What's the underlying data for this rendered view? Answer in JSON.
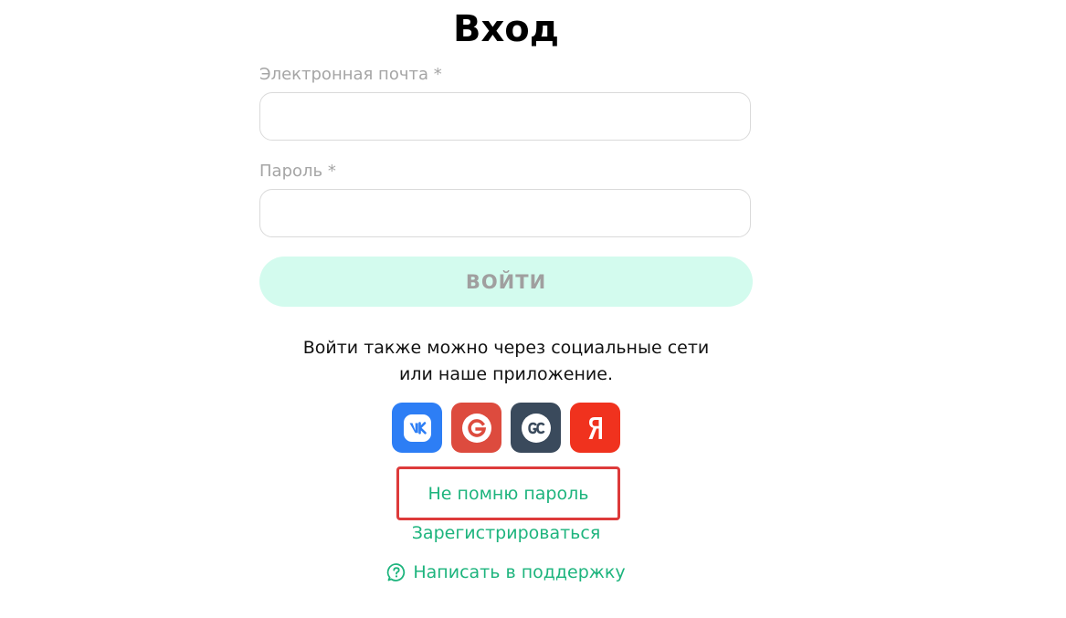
{
  "page": {
    "title": "Вход"
  },
  "form": {
    "email_label": "Электронная почта *",
    "email_value": "",
    "password_label": "Пароль *",
    "password_value": "",
    "submit_label": "ВОЙТИ"
  },
  "social": {
    "hint_line1": "Войти также можно через социальные сети",
    "hint_line2": "или наше приложение.",
    "buttons": [
      {
        "name": "vk",
        "glyph": "VK",
        "icon": "vk-icon",
        "color": "#2d7ef5"
      },
      {
        "name": "google",
        "glyph": "G",
        "icon": "google-icon",
        "color": "#dd4b3e"
      },
      {
        "name": "getcourse",
        "glyph": "GC",
        "icon": "getcourse-icon",
        "color": "#3a4a5c"
      },
      {
        "name": "yandex",
        "glyph": "Я",
        "icon": "yandex-icon",
        "color": "#f0321e"
      }
    ]
  },
  "links": {
    "forgot_password": "Не помню пароль",
    "register": "Зарегистрироваться",
    "support": "Написать в поддержку"
  },
  "colors": {
    "accent_green": "#1db47d",
    "button_bg": "#d3fbee",
    "highlight_border": "#dd3a3a",
    "label_gray": "#a5a5a5"
  }
}
